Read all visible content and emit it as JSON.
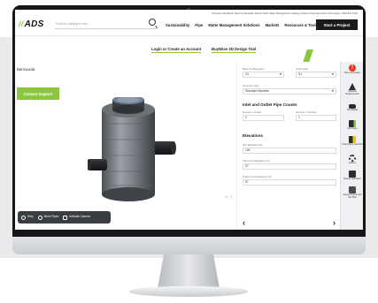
{
  "header": {
    "utility_links": [
      "Drainage Handbook",
      "Fleet Sustainability Report 2022",
      "Water Management Catalog",
      "Careers",
      "Find Aqua Tech",
      "Find a Rep",
      "1-800-821-6710"
    ],
    "logo": "ADS",
    "search_placeholder": "Search adspipe.com",
    "nav": [
      "Sustainability",
      "Pipe",
      "Water Management Solutions",
      "Markets",
      "Resources & Tools"
    ],
    "cta": "Start a Project"
  },
  "subbar": {
    "login": "Login or Create an Account",
    "tool": "BuyWise 3D Design Tool"
  },
  "viewer": {
    "label": "Barracuda",
    "contact_button": "Contact Support",
    "toolbar": [
      "Help",
      "Move Pipes",
      "Activate Camera"
    ]
  },
  "form": {
    "top_label_1": "Base Configuration",
    "top_value_1": "24",
    "top_label_2": "Outlet Size",
    "top_value_2": "S1",
    "structure_label": "Structure Type",
    "structure_value": "Standard Manhole",
    "inlet_heading": "Inlet and Outlet Pipe Counts",
    "inlets_label": "Number of Inlets",
    "inlets_value": "0",
    "outlets_label": "Number of Outlets",
    "outlets_value": "1",
    "elevations_heading": "Elevations",
    "rim_label": "Rim Elevation (ft)",
    "rim_value": "100",
    "invert_in_label": "Inlet Invert Elevation (ft)",
    "invert_in_value": "97",
    "invert_out_label": "Outlet Invert Elevation (ft)",
    "invert_out_value": "97"
  },
  "rail": [
    {
      "label": "More Information",
      "icon": "alert-icon"
    },
    {
      "label": "Hydraulic Requirements",
      "icon": "flask-icon"
    },
    {
      "label": "Site Details",
      "icon": "pipe-icon"
    },
    {
      "label": "Inlet Pipes",
      "icon": "inlet-pipes-icon"
    },
    {
      "label": "Outlet Pipes and Flow",
      "icon": "outlet-flow-icon"
    },
    {
      "label": "Options",
      "icon": "gears-icon"
    },
    {
      "label": "Review Calculator",
      "icon": "calculator-icon"
    },
    {
      "label": "Request Quote and Site Plan",
      "icon": "site-plan-icon"
    }
  ],
  "colors": {
    "accent": "#8cc63f",
    "dark": "#1a1a1a",
    "alert": "#e3371e"
  }
}
